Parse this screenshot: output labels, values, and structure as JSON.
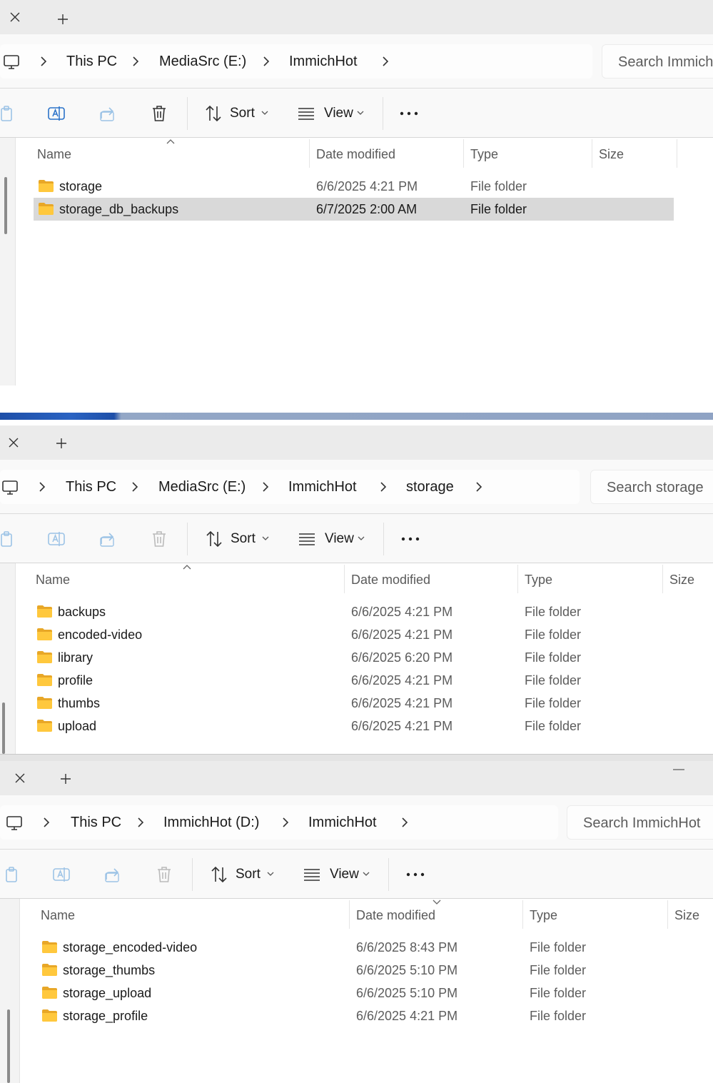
{
  "common": {
    "new_tab": "+",
    "close_tab": "×",
    "sort_label": "Sort",
    "view_label": "View",
    "more_label": "•••",
    "columns": {
      "name": "Name",
      "date_modified": "Date modified",
      "type": "Type",
      "size": "Size"
    },
    "colors": {
      "folder": "#ffc83d",
      "folder_dark": "#e8a727",
      "selected_row": "#d9d9d9",
      "taskbar_blue": "#1e4fa8"
    }
  },
  "window1": {
    "breadcrumb": [
      "This PC",
      "MediaSrc (E:)",
      "ImmichHot"
    ],
    "search_placeholder": "Search ImmichHot",
    "sorted_by": "Name",
    "rows": [
      {
        "name": "storage",
        "date": "6/6/2025 4:21 PM",
        "type": "File folder",
        "selected": false
      },
      {
        "name": "storage_db_backups",
        "date": "6/7/2025 2:00 AM",
        "type": "File folder",
        "selected": true
      }
    ]
  },
  "window2": {
    "breadcrumb": [
      "This PC",
      "MediaSrc (E:)",
      "ImmichHot",
      "storage"
    ],
    "search_placeholder": "Search storage",
    "sorted_by": "Name",
    "rows": [
      {
        "name": "backups",
        "date": "6/6/2025 4:21 PM",
        "type": "File folder"
      },
      {
        "name": "encoded-video",
        "date": "6/6/2025 4:21 PM",
        "type": "File folder"
      },
      {
        "name": "library",
        "date": "6/6/2025 6:20 PM",
        "type": "File folder"
      },
      {
        "name": "profile",
        "date": "6/6/2025 4:21 PM",
        "type": "File folder"
      },
      {
        "name": "thumbs",
        "date": "6/6/2025 4:21 PM",
        "type": "File folder"
      },
      {
        "name": "upload",
        "date": "6/6/2025 4:21 PM",
        "type": "File folder"
      }
    ]
  },
  "window3": {
    "breadcrumb": [
      "This PC",
      "ImmichHot (D:)",
      "ImmichHot"
    ],
    "search_placeholder": "Search ImmichHot",
    "sorted_by": "Date modified",
    "rows": [
      {
        "name": "storage_encoded-video",
        "date": "6/6/2025 8:43 PM",
        "type": "File folder"
      },
      {
        "name": "storage_thumbs",
        "date": "6/6/2025 5:10 PM",
        "type": "File folder"
      },
      {
        "name": "storage_upload",
        "date": "6/6/2025 5:10 PM",
        "type": "File folder"
      },
      {
        "name": "storage_profile",
        "date": "6/6/2025 4:21 PM",
        "type": "File folder"
      }
    ]
  }
}
